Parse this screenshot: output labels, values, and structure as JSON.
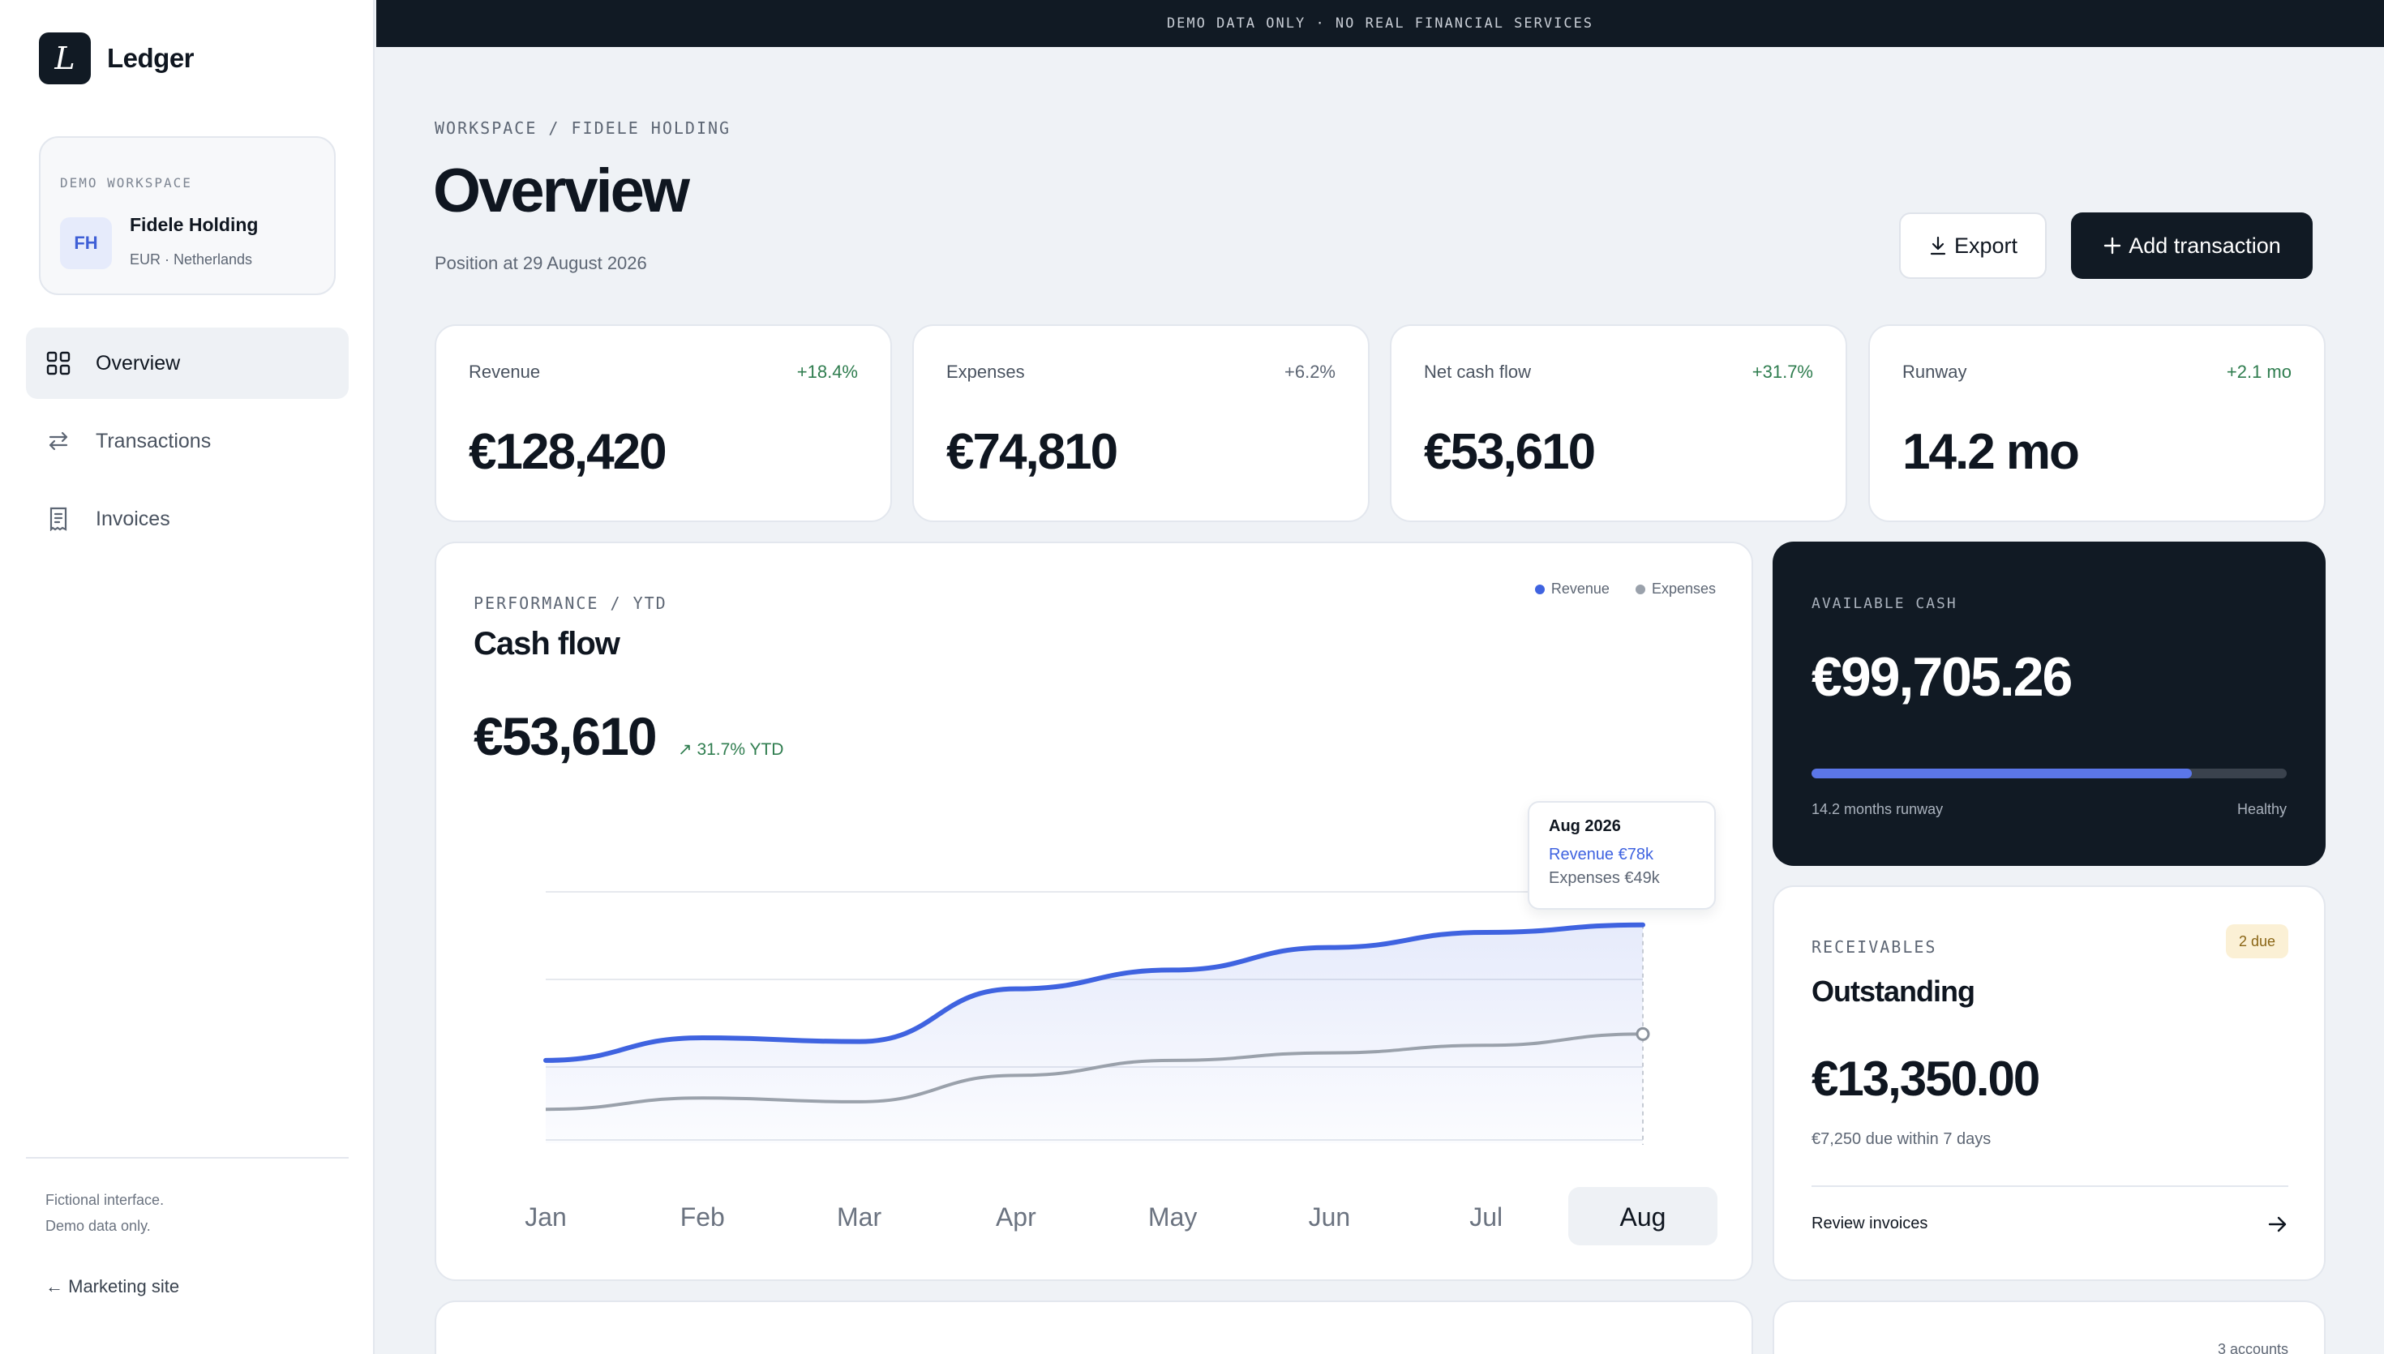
{
  "brand": {
    "mark": "L",
    "name": "Ledger"
  },
  "workspace": {
    "tag": "DEMO WORKSPACE",
    "initials": "FH",
    "name": "Fidele Holding",
    "sub": "EUR · Netherlands"
  },
  "nav": [
    {
      "label": "Overview",
      "icon": "grid-icon",
      "active": true
    },
    {
      "label": "Transactions",
      "icon": "arrows-swap-icon",
      "active": false
    },
    {
      "label": "Invoices",
      "icon": "document-icon",
      "active": false
    }
  ],
  "sidebar_footer": {
    "note_1": "Fictional interface.",
    "note_2": "Demo data only.",
    "link": "← Marketing site"
  },
  "banner": "DEMO DATA ONLY · NO REAL FINANCIAL SERVICES",
  "header": {
    "breadcrumb": "WORKSPACE / FIDELE HOLDING",
    "title": "Overview",
    "subtitle": "Position at 29 August 2026",
    "export_label": "Export",
    "add_label": "Add transaction"
  },
  "kpis": [
    {
      "label": "Revenue",
      "delta": "+18.4%",
      "value": "€128,420",
      "tone": "pos"
    },
    {
      "label": "Expenses",
      "delta": "+6.2%",
      "value": "€74,810",
      "tone": "neu"
    },
    {
      "label": "Net cash flow",
      "delta": "+31.7%",
      "value": "€53,610",
      "tone": "pos"
    },
    {
      "label": "Runway",
      "delta": "+2.1 mo",
      "value": "14.2 mo",
      "tone": "pos"
    }
  ],
  "cashflow": {
    "tag": "PERFORMANCE / YTD",
    "title": "Cash flow",
    "value": "€53,610",
    "change": "31.7% YTD",
    "legend": {
      "revenue": "Revenue",
      "expenses": "Expenses"
    },
    "tooltip": {
      "title": "Aug 2026",
      "revenue": "Revenue €78k",
      "expenses": "Expenses €49k"
    }
  },
  "chart_data": {
    "type": "area",
    "categories": [
      "Jan",
      "Feb",
      "Mar",
      "Apr",
      "May",
      "Jun",
      "Jul",
      "Aug"
    ],
    "selected": "Aug",
    "series": [
      {
        "name": "Revenue",
        "values": [
          42,
          48,
          47,
          61,
          66,
          72,
          76,
          78
        ],
        "color": "#3f63e0"
      },
      {
        "name": "Expenses",
        "values": [
          29,
          32,
          31,
          38,
          42,
          44,
          46,
          49
        ],
        "color": "#9aa1ab"
      }
    ],
    "ylim": [
      20,
      90
    ]
  },
  "cash": {
    "tag": "AVAILABLE CASH",
    "value": "€99,705.26",
    "progress": 0.8,
    "runway": "14.2 months runway",
    "status": "Healthy"
  },
  "receivables": {
    "tag": "RECEIVABLES",
    "badge": "2 due",
    "title": "Outstanding",
    "value": "€13,350.00",
    "sub": "€7,250 due within 7 days",
    "link": "Review invoices"
  },
  "accounts": {
    "count": "3 accounts"
  },
  "colors": {
    "accent": "#3f63e0",
    "dark": "#111a24",
    "positive": "#2f7d4f"
  }
}
